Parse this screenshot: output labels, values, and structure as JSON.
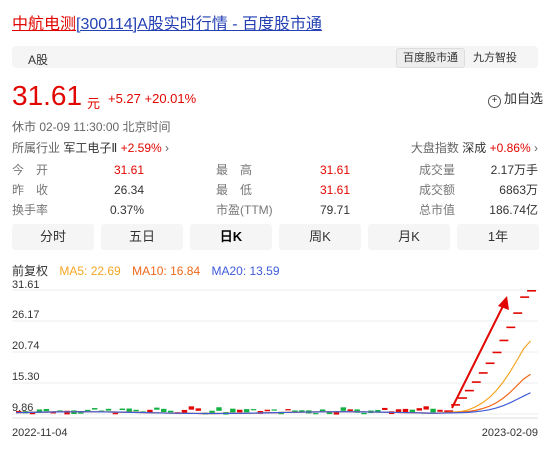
{
  "title": {
    "stock": "中航电测",
    "code": "[300114]",
    "rest": "A股实时行情 - 百度股市通"
  },
  "tag": "A股",
  "pills": [
    "百度股市通",
    "九方智投"
  ],
  "price": "31.61",
  "price_unit": "元",
  "change": "+5.27 +20.01%",
  "add_watchlist": "加自选",
  "status": "休市  02-09 11:30:00  北京时间",
  "industry": {
    "label": "所属行业",
    "name": "军工电子Ⅱ",
    "pct": "+2.59%"
  },
  "index": {
    "label": "大盘指数",
    "name": "深成",
    "pct": "+0.86%"
  },
  "stats": [
    [
      {
        "l": "今　开",
        "v": "31.61",
        "red": true
      },
      {
        "l": "最　高",
        "v": "31.61",
        "red": true
      },
      {
        "l": "成交量",
        "v": "2.17万手",
        "red": false
      }
    ],
    [
      {
        "l": "昨　收",
        "v": "26.34",
        "red": false
      },
      {
        "l": "最　低",
        "v": "31.61",
        "red": true
      },
      {
        "l": "成交额",
        "v": "6863万",
        "red": false
      }
    ],
    [
      {
        "l": "换手率",
        "v": "0.37%",
        "red": false
      },
      {
        "l": "市盈(TTM)",
        "v": "79.71",
        "red": false
      },
      {
        "l": "总市值",
        "v": "186.74亿",
        "red": false
      }
    ]
  ],
  "tabs": [
    "分时",
    "五日",
    "日K",
    "周K",
    "月K",
    "1年"
  ],
  "active_tab": 2,
  "ma": {
    "adj": "前复权",
    "ma5": "MA5: 22.69",
    "ma10": "MA10: 16.84",
    "ma20": "MA20: 13.59"
  },
  "colors": {
    "up": "#e10601",
    "ma5": "#f5a623",
    "ma10": "#f0681a",
    "ma20": "#3f5bd8",
    "down": "#14b143"
  },
  "chart_data": {
    "type": "line",
    "y_ticks": [
      "31.61",
      "26.17",
      "20.74",
      "15.30",
      "9.86"
    ],
    "ylim": [
      9.86,
      31.61
    ],
    "x_labels": [
      "2022-11-04",
      "2023-02-09"
    ],
    "candles_tail": [
      10.5,
      11.6,
      12.8,
      14.1,
      15.6,
      17.2,
      18.9,
      20.8,
      22.9,
      25.2,
      27.7,
      30.5,
      31.61
    ],
    "series": [
      {
        "key": "ma5",
        "tail": [
          10.3,
          10.6,
          11.1,
          11.8,
          12.7,
          13.9,
          15.4,
          17.2,
          19.2,
          21.3,
          22.69
        ]
      },
      {
        "key": "ma10",
        "tail": [
          10.2,
          10.3,
          10.5,
          10.8,
          11.2,
          11.8,
          12.6,
          13.6,
          14.8,
          16.0,
          16.84
        ]
      },
      {
        "key": "ma20",
        "tail": [
          10.1,
          10.15,
          10.25,
          10.4,
          10.6,
          10.9,
          11.3,
          11.8,
          12.4,
          13.0,
          13.59
        ]
      }
    ]
  }
}
